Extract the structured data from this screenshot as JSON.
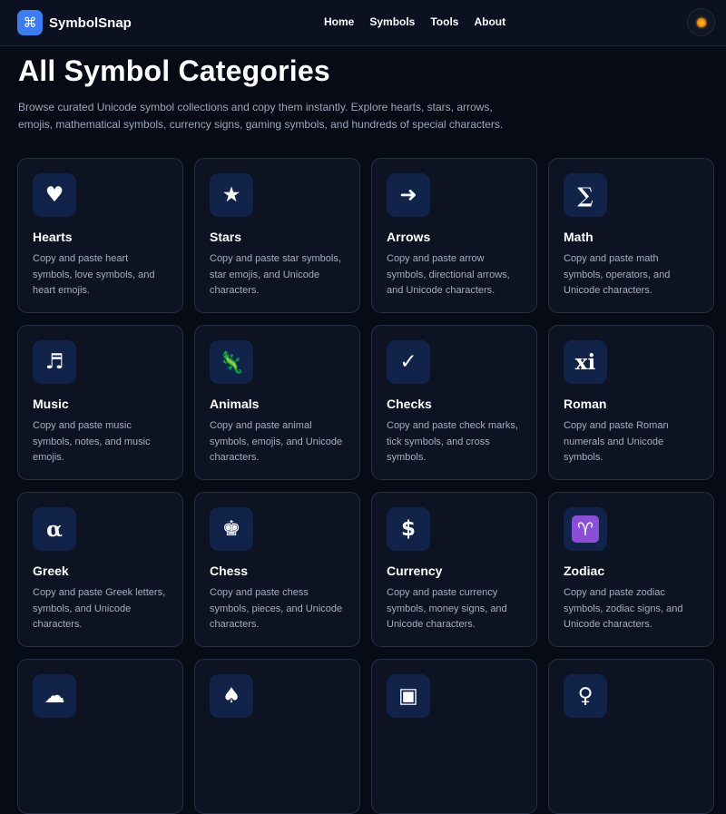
{
  "brand": {
    "logo_glyph": "⌘",
    "name": "SymbolSnap"
  },
  "nav": {
    "links": [
      "Home",
      "Symbols",
      "Tools",
      "About"
    ]
  },
  "header": {
    "title": "All Symbol Categories",
    "intro": "Browse curated Unicode symbol collections and copy them instantly. Explore hearts, stars, arrows, emojis, mathematical symbols, currency signs, gaming symbols, and hundreds of special characters."
  },
  "categories": [
    {
      "icon": "♥",
      "icon_name": "heart-icon",
      "title": "Hearts",
      "desc": "Copy and paste heart symbols, love symbols, and heart emojis."
    },
    {
      "icon": "★",
      "icon_name": "star-icon",
      "title": "Stars",
      "desc": "Copy and paste star symbols, star emojis, and Unicode characters."
    },
    {
      "icon": "➜",
      "icon_name": "arrow-icon",
      "title": "Arrows",
      "desc": "Copy and paste arrow symbols, directional arrows, and Unicode characters."
    },
    {
      "icon": "∑",
      "icon_name": "sigma-icon",
      "title": "Math",
      "desc": "Copy and paste math symbols, operators, and Unicode characters."
    },
    {
      "icon": "♬",
      "icon_name": "music-note-icon",
      "title": "Music",
      "desc": "Copy and paste music symbols, notes, and music emojis."
    },
    {
      "icon": "🦎",
      "icon_name": "lizard-icon",
      "title": "Animals",
      "desc": "Copy and paste animal symbols, emojis, and Unicode characters."
    },
    {
      "icon": "✓",
      "icon_name": "check-icon",
      "title": "Checks",
      "desc": "Copy and paste check marks, tick symbols, and cross symbols."
    },
    {
      "icon": "xi",
      "icon_name": "roman-numeral-icon",
      "title": "Roman",
      "desc": "Copy and paste Roman numerals and Unicode symbols."
    },
    {
      "icon": "α",
      "icon_name": "alpha-icon",
      "title": "Greek",
      "desc": "Copy and paste Greek letters, symbols, and Unicode characters."
    },
    {
      "icon": "♚",
      "icon_name": "chess-king-icon",
      "title": "Chess",
      "desc": "Copy and paste chess symbols, pieces, and Unicode characters."
    },
    {
      "icon": "$",
      "icon_name": "dollar-icon",
      "title": "Currency",
      "desc": "Copy and paste currency symbols, money signs, and Unicode characters."
    },
    {
      "icon": "♈",
      "icon_name": "aries-icon",
      "title": "Zodiac",
      "desc": "Copy and paste zodiac symbols, zodiac signs, and Unicode characters."
    },
    {
      "icon": "☁",
      "icon_name": "snow-cloud-icon",
      "title": "",
      "desc": ""
    },
    {
      "icon": "♠",
      "icon_name": "spade-icon",
      "title": "",
      "desc": ""
    },
    {
      "icon": "▣",
      "icon_name": "square-icon",
      "title": "",
      "desc": ""
    },
    {
      "icon": "♀",
      "icon_name": "female-sign-icon",
      "title": "",
      "desc": ""
    }
  ],
  "colors": {
    "background": "#070b16",
    "accent": "#3b7cf0",
    "card_background": "#0d1322",
    "icon_box": "#12234a",
    "zodiac_icon": "#8a4fd6"
  }
}
